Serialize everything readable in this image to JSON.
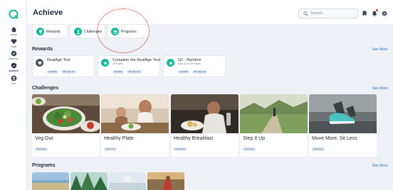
{
  "app": {
    "page_title": "Achieve",
    "logo_icon": "app-logo-icon",
    "accent_color": "#16b99a"
  },
  "sidebar": {
    "items": [
      {
        "label": "Home",
        "icon": "home-icon"
      },
      {
        "label": "Track",
        "icon": "heart-icon"
      },
      {
        "label": "Discover",
        "icon": "compass-icon"
      },
      {
        "label": "Achieve",
        "icon": "shield-icon",
        "active": true
      },
      {
        "label": "You",
        "icon": "person-icon"
      }
    ]
  },
  "header": {
    "search_placeholder": "Search",
    "icons": [
      "bookmark-icon",
      "notification-icon",
      "gear-icon"
    ]
  },
  "tabs": [
    {
      "label": "Rewards",
      "icon": "trophy-icon"
    },
    {
      "label": "Challenges",
      "icon": "person-icon"
    },
    {
      "label": "Programs",
      "icon": "calendar-icon"
    }
  ],
  "rewards": {
    "title": "Rewards",
    "see_more": "See More",
    "items": [
      {
        "title": "RealAge Test",
        "subtitle": "",
        "badges": [
          "Available",
          "384 days left"
        ],
        "icon": "heart-icon"
      },
      {
        "title": "Complete the RealAge Test",
        "subtitle": "25 Points",
        "badges": [
          "Available",
          "379 days left"
        ],
        "icon": "star-icon"
      },
      {
        "title": "Q1 - Nutrition",
        "subtitle": "Earn up to 25 Points",
        "badges": [
          "Available",
          "105 days left"
        ],
        "icon": "star-icon"
      }
    ]
  },
  "challenges": {
    "title": "Challenges",
    "see_more": "See More",
    "items": [
      {
        "title": "Veg Out",
        "badge": "Upcoming"
      },
      {
        "title": "Healthy Plate",
        "badge": "Upcoming"
      },
      {
        "title": "Healthy Breakfast",
        "badge": "Upcoming"
      },
      {
        "title": "Step It Up",
        "badge": "Upcoming"
      },
      {
        "title": "Move More, Sit Less",
        "badge": "Upcoming"
      }
    ]
  },
  "programs": {
    "title": "Programs",
    "see_more": "See More"
  }
}
